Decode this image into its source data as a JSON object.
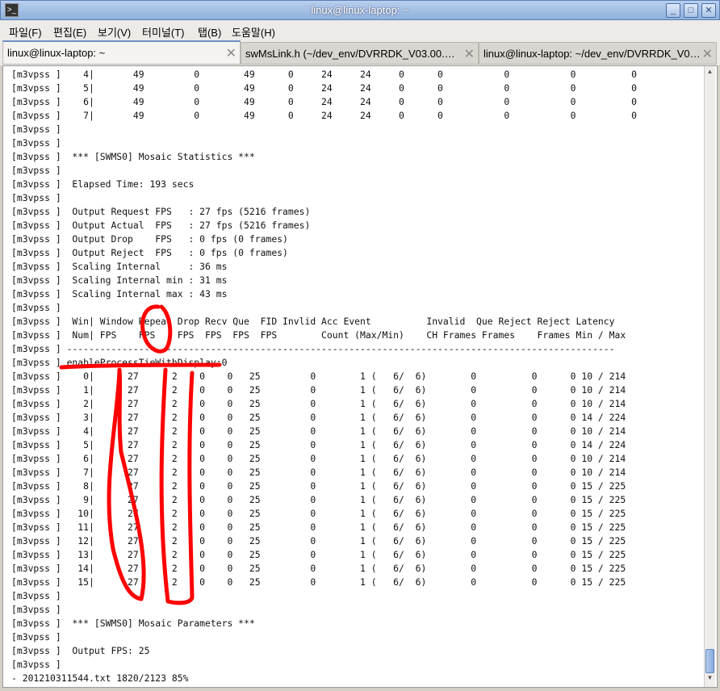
{
  "window": {
    "title": "linux@linux-laptop: ~",
    "icon": "terminal-icon"
  },
  "menu": [
    "파일(F)",
    "편집(E)",
    "보기(V)",
    "터미널(T)",
    "탭(B)",
    "도움말(H)"
  ],
  "tabs": [
    {
      "label": "linux@linux-laptop: ~",
      "active": true
    },
    {
      "label": "swMsLink.h (~/dev_env/DVRRDK_V03.00.…"
    },
    {
      "label": "linux@linux-laptop: ~/dev_env/DVRRDK_V0…"
    }
  ],
  "annotation_color": "#ff0000",
  "terminal": {
    "lines": [
      "[m3vpss ]    4|       49         0        49      0     24     24     0      0           0           0          0",
      "[m3vpss ]    5|       49         0        49      0     24     24     0      0           0           0          0",
      "[m3vpss ]    6|       49         0        49      0     24     24     0      0           0           0          0",
      "[m3vpss ]    7|       49         0        49      0     24     24     0      0           0           0          0",
      "[m3vpss ]",
      "[m3vpss ]",
      "[m3vpss ]  *** [SWMS0] Mosaic Statistics ***",
      "[m3vpss ]",
      "[m3vpss ]  Elapsed Time: 193 secs",
      "[m3vpss ]",
      "[m3vpss ]  Output Request FPS   : 27 fps (5216 frames)",
      "[m3vpss ]  Output Actual  FPS   : 27 fps (5216 frames)",
      "[m3vpss ]  Output Drop    FPS   : 0 fps (0 frames)",
      "[m3vpss ]  Output Reject  FPS   : 0 fps (0 frames)",
      "[m3vpss ]  Scaling Internal     : 36 ms",
      "[m3vpss ]  Scaling Internal min : 31 ms",
      "[m3vpss ]  Scaling Internal max : 43 ms",
      "[m3vpss ]",
      "[m3vpss ]  Win| Window Repeat Drop Recv Que  FID Invlid Acc Event          Invalid  Que Reject Reject Latency",
      "[m3vpss ]  Num| FPS    FPS    FPS  FPS  FPS  FPS        Count (Max/Min)    CH Frames Frames    Frames Min / Max",
      "[m3vpss ] ---------------------------------------------------------------------------------------------------",
      "[m3vpss ] enableProcessTieWithDisplay:0",
      "[m3vpss ]    0|      27      2    0    0   25         0        1 (   6/  6)        0          0      0 10 / 214",
      "[m3vpss ]    1|      27      2    0    0   25         0        1 (   6/  6)        0          0      0 10 / 214",
      "[m3vpss ]    2|      27      2    0    0   25         0        1 (   6/  6)        0          0      0 10 / 214",
      "[m3vpss ]    3|      27      2    0    0   25         0        1 (   6/  6)        0          0      0 14 / 224",
      "[m3vpss ]    4|      27      2    0    0   25         0        1 (   6/  6)        0          0      0 10 / 214",
      "[m3vpss ]    5|      27      2    0    0   25         0        1 (   6/  6)        0          0      0 14 / 224",
      "[m3vpss ]    6|      27      2    0    0   25         0        1 (   6/  6)        0          0      0 10 / 214",
      "[m3vpss ]    7|      27      2    0    0   25         0        1 (   6/  6)        0          0      0 10 / 214",
      "[m3vpss ]    8|      27      2    0    0   25         0        1 (   6/  6)        0          0      0 15 / 225",
      "[m3vpss ]    9|      27      2    0    0   25         0        1 (   6/  6)        0          0      0 15 / 225",
      "[m3vpss ]   10|      27      2    0    0   25         0        1 (   6/  6)        0          0      0 15 / 225",
      "[m3vpss ]   11|      27      2    0    0   25         0        1 (   6/  6)        0          0      0 15 / 225",
      "[m3vpss ]   12|      27      2    0    0   25         0        1 (   6/  6)        0          0      0 15 / 225",
      "[m3vpss ]   13|      27      2    0    0   25         0        1 (   6/  6)        0          0      0 15 / 225",
      "[m3vpss ]   14|      27      2    0    0   25         0        1 (   6/  6)        0          0      0 15 / 225",
      "[m3vpss ]   15|      27      2    0    0   25         0        1 (   6/  6)        0          0      0 15 / 225",
      "[m3vpss ]",
      "[m3vpss ]",
      "[m3vpss ]  *** [SWMS0] Mosaic Parameters ***",
      "[m3vpss ]",
      "[m3vpss ]  Output FPS: 25",
      "[m3vpss ]",
      "- 201210311544.txt 1820/2123 85%"
    ]
  }
}
